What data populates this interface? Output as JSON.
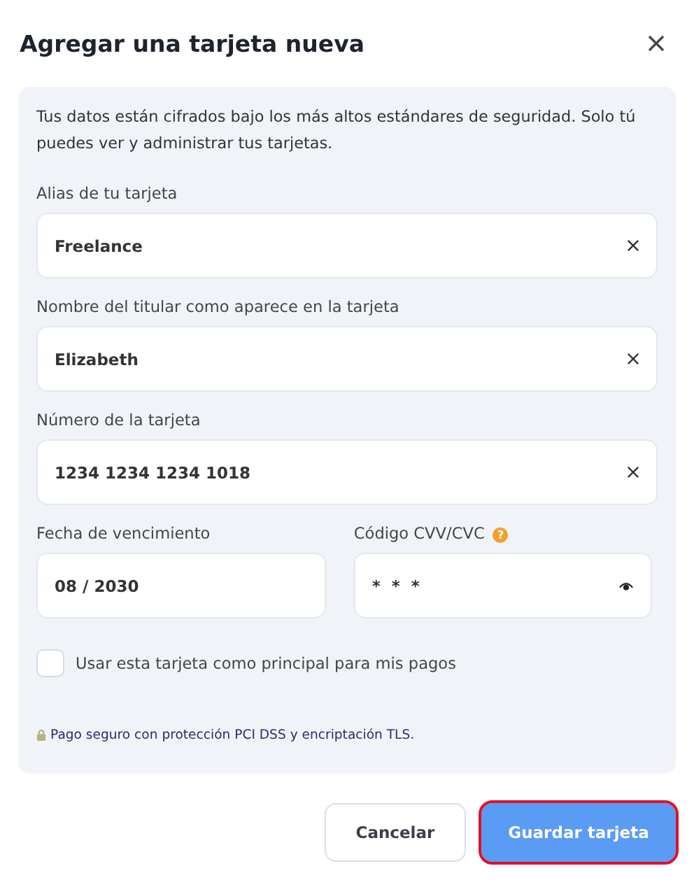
{
  "dialog": {
    "title": "Agregar una tarjeta nueva"
  },
  "notice": "Tus datos están cifrados bajo los más altos estándares de seguridad. Solo tú puedes ver y administrar tus tarjetas.",
  "fields": [
    {
      "label": "Alias de tu tarjeta",
      "value": "Freelance",
      "kind": "clearable"
    },
    {
      "label": "Nombre del titular como aparece en la tarjeta",
      "value": "Elizabeth",
      "kind": "clearable"
    },
    {
      "label": "Número de la tarjeta",
      "value": "1234 1234 1234 1018",
      "kind": "clearable"
    }
  ],
  "row_fields": [
    {
      "label": "Fecha de vencimiento",
      "value": "08 / 2030",
      "kind": "plain"
    },
    {
      "label": "Código CVV/CVC",
      "help": "?",
      "value": "* * *",
      "kind": "secret"
    }
  ],
  "default_checkbox": {
    "label": "Usar esta tarjeta como principal para mis pagos",
    "checked": false
  },
  "security_note": "Pago seguro con protección PCI DSS y encriptación TLS.",
  "buttons": [
    {
      "label": "Cancelar",
      "kind": "secondary",
      "highlighted": false
    },
    {
      "label": "Guardar tarjeta",
      "kind": "primary",
      "highlighted": true
    }
  ]
}
